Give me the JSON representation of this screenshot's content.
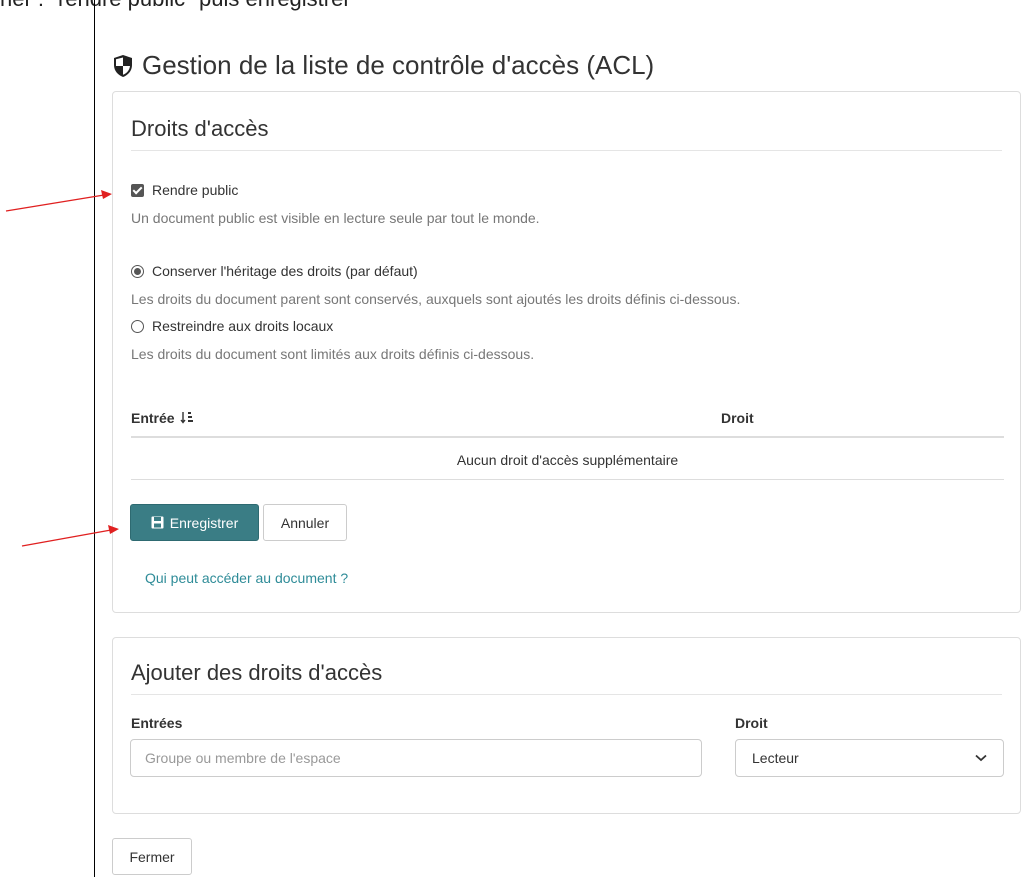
{
  "caption": {
    "text": "ner : \"rendre public\" puis enregistrer"
  },
  "title": "Gestion de la liste de contrôle d'accès (ACL)",
  "rights_panel": {
    "heading": "Droits d'accès",
    "public_checkbox": {
      "label": "Rendre public",
      "checked": true
    },
    "public_hint": "Un document public est visible en lecture seule par tout le monde.",
    "inherit_radio": {
      "label": "Conserver l'héritage des droits (par défaut)",
      "selected": true
    },
    "inherit_hint": "Les droits du document parent sont conservés, auxquels sont ajoutés les droits définis ci-dessous.",
    "local_radio": {
      "label": "Restreindre aux droits locaux",
      "selected": false
    },
    "local_hint": "Les droits du document sont limités aux droits définis ci-dessous.",
    "table": {
      "col_entree": "Entrée",
      "col_droit": "Droit",
      "empty": "Aucun droit d'accès supplémentaire"
    },
    "save_label": "Enregistrer",
    "cancel_label": "Annuler",
    "who_link": "Qui peut accéder au document ?"
  },
  "add_panel": {
    "heading": "Ajouter des droits d'accès",
    "entries_label": "Entrées",
    "entries_placeholder": "Groupe ou membre de l'espace",
    "right_label": "Droit",
    "right_value": "Lecteur"
  },
  "close_label": "Fermer",
  "colors": {
    "primary": "#3a7d85",
    "link": "#2f8c98",
    "annotation_arrow": "#e02020"
  }
}
